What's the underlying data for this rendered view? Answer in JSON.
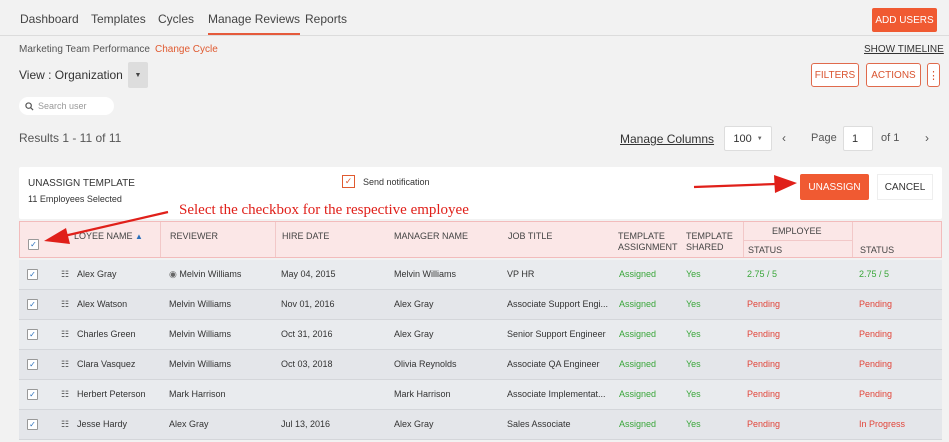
{
  "nav": {
    "tabs": [
      "Dashboard",
      "Templates",
      "Cycles",
      "Manage Reviews",
      "Reports"
    ],
    "active_tab": "Manage Reviews",
    "add_users_label": "ADD USERS"
  },
  "cycle": {
    "name": "Marketing Team Performance",
    "change_label": "Change Cycle",
    "show_timeline_label": "SHOW TIMELINE"
  },
  "view": {
    "label": "View : Organization"
  },
  "toolbar": {
    "filters_label": "FILTERS",
    "actions_label": "ACTIONS",
    "more_label": "⋮"
  },
  "search": {
    "placeholder": "Search user"
  },
  "results": {
    "text": "Results 1 - 11 of 11"
  },
  "pager": {
    "manage_columns_label": "Manage Columns",
    "page_size": "100",
    "page_label": "Page",
    "page_value": "1",
    "of_label": "of 1"
  },
  "unassign": {
    "title": "UNASSIGN TEMPLATE",
    "selected_text": "11 Employees Selected",
    "send_notification_label": "Send notification",
    "unassign_label": "UNASSIGN",
    "cancel_label": "CANCEL"
  },
  "annotation": {
    "text": "Select the checkbox for the respective employee"
  },
  "table": {
    "headers": {
      "employee_name": "LOYEE NAME",
      "reviewer": "REVIEWER",
      "hire_date": "HIRE DATE",
      "manager_name": "MANAGER NAME",
      "job_title": "JOB TITLE",
      "template_assignment_1": "TEMPLATE",
      "template_assignment_2": "ASSIGNMENT",
      "template_shared_1": "TEMPLATE",
      "template_shared_2": "SHARED",
      "employee_group": "EMPLOYEE",
      "status_1": "STATUS",
      "status_2": "STATUS"
    },
    "rows": [
      {
        "name": "Alex Gray",
        "reviewer": "Melvin Williams",
        "reviewer_icon": true,
        "hire_date": "May 04, 2015",
        "manager": "Melvin Williams",
        "job_title": "VP HR",
        "assignment": "Assigned",
        "shared": "Yes",
        "employee_status": "2.75 / 5",
        "status": "2.75 / 5",
        "status_color": "green"
      },
      {
        "name": "Alex Watson",
        "reviewer": "Melvin Williams",
        "reviewer_icon": false,
        "hire_date": "Nov 01, 2016",
        "manager": "Alex Gray",
        "job_title": "Associate Support Engi...",
        "assignment": "Assigned",
        "shared": "Yes",
        "employee_status": "Pending",
        "status": "Pending",
        "status_color": "red"
      },
      {
        "name": "Charles Green",
        "reviewer": "Melvin Williams",
        "reviewer_icon": false,
        "hire_date": "Oct 31, 2016",
        "manager": "Alex Gray",
        "job_title": "Senior Support Engineer",
        "assignment": "Assigned",
        "shared": "Yes",
        "employee_status": "Pending",
        "status": "Pending",
        "status_color": "red"
      },
      {
        "name": "Clara Vasquez",
        "reviewer": "Melvin Williams",
        "reviewer_icon": false,
        "hire_date": "Oct 03, 2018",
        "manager": "Olivia Reynolds",
        "job_title": "Associate QA Engineer",
        "assignment": "Assigned",
        "shared": "Yes",
        "employee_status": "Pending",
        "status": "Pending",
        "status_color": "red"
      },
      {
        "name": "Herbert Peterson",
        "reviewer": "Mark Harrison",
        "reviewer_icon": false,
        "hire_date": "",
        "manager": "Mark Harrison",
        "job_title": "Associate Implementat...",
        "assignment": "Assigned",
        "shared": "Yes",
        "employee_status": "Pending",
        "status": "Pending",
        "status_color": "red"
      },
      {
        "name": "Jesse Hardy",
        "reviewer": "Alex Gray",
        "reviewer_icon": false,
        "hire_date": "Jul 13, 2016",
        "manager": "Alex Gray",
        "job_title": "Sales Associate",
        "assignment": "Assigned",
        "shared": "Yes",
        "employee_status": "Pending",
        "status": "In Progress",
        "status_color": "red"
      }
    ]
  },
  "colors": {
    "accent": "#f05a32",
    "header_bg": "#fbe7e7",
    "green": "#3aa63a",
    "red": "#e2453a"
  }
}
